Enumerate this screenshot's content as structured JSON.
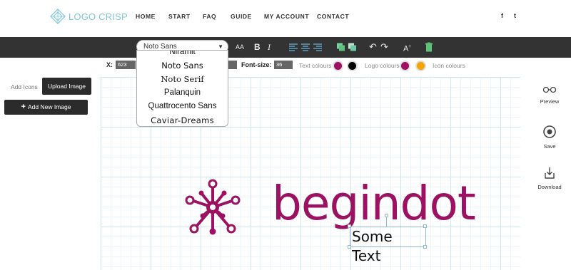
{
  "header": {
    "logo_text": "LOGO CRISP",
    "nav": [
      {
        "label": "HOME",
        "name": "nav-home"
      },
      {
        "label": "START",
        "name": "nav-start"
      },
      {
        "label": "FAQ",
        "name": "nav-faq"
      },
      {
        "label": "GUIDE",
        "name": "nav-guide"
      },
      {
        "label": "MY ACCOUNT",
        "name": "nav-my-account"
      },
      {
        "label": "CONTACT",
        "name": "nav-contact"
      }
    ],
    "social": [
      "f",
      "t"
    ]
  },
  "toolbar": {
    "font_selected": "Noto Sans",
    "font_size_label": "AA",
    "bold_label": "B",
    "italic_label": "I",
    "icons": [
      "align-left-icon",
      "align-center-icon",
      "align-right-icon",
      "copy-icon",
      "layer-icon",
      "undo-icon",
      "redo-icon",
      "text-size-icon",
      "delete-icon"
    ]
  },
  "font_dropdown": {
    "options": [
      "Niramit",
      "Noto Sans",
      "Noto Serif",
      "Palanquin",
      "Quattrocento Sans",
      "Caviar-Dreams"
    ]
  },
  "props": {
    "x_label": "X:",
    "x_value": "623",
    "font_size_label": "Font-size:",
    "font_size_value": "36",
    "text_colours_label": "Text colours",
    "logo_colours_label": "Logo colours",
    "icon_colours_label": "Icon colours",
    "text_colours": [
      "#9c1161",
      "#000000"
    ],
    "logo_colours": [
      "#9c1161",
      "#f5a300"
    ]
  },
  "left_panel": {
    "add_icons_label": "Add Icons",
    "upload_image_label": "Upload Image",
    "add_new_image_label": "Add New Image"
  },
  "right_panel": {
    "preview_label": "Preview",
    "save_label": "Save",
    "download_label": "Download"
  },
  "canvas": {
    "brand_text": "begindot",
    "brand_color": "#9c1161",
    "sub_text": "Some Text"
  }
}
